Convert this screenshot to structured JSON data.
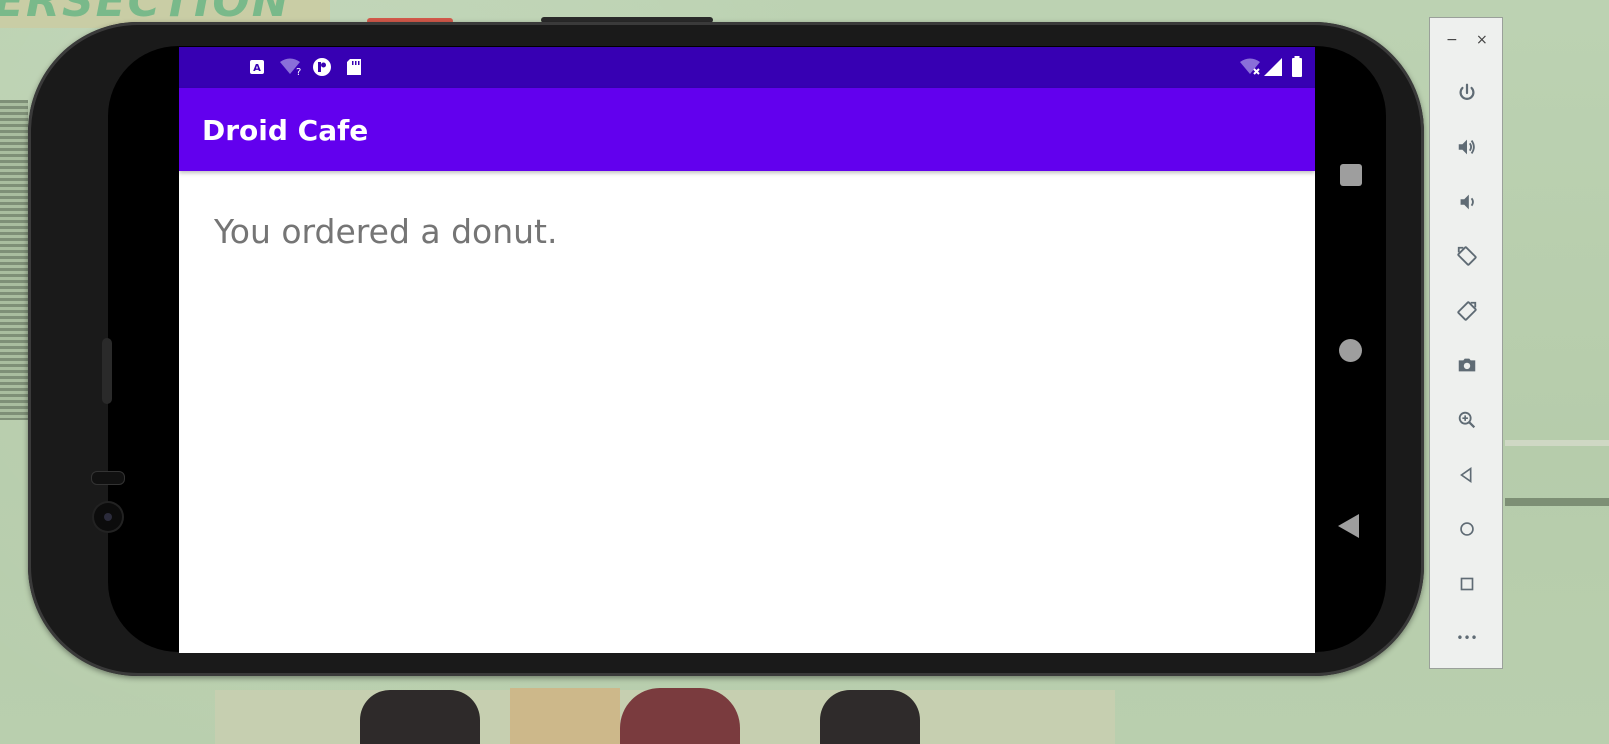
{
  "wallpaper": {
    "title_fragment": "ERSECTION"
  },
  "status_bar": {
    "left_icons": [
      "a-icon",
      "wifi-question-icon",
      "notification-icon",
      "sd-card-icon"
    ],
    "right_icons": [
      "wifi-off-icon",
      "signal-icon",
      "battery-icon"
    ]
  },
  "app_bar": {
    "title": "Droid Cafe"
  },
  "content": {
    "message": "You ordered a donut."
  },
  "emulator_toolbar": {
    "window_minimize": "−",
    "window_close": "×",
    "buttons": [
      "power",
      "volume-up",
      "volume-down",
      "rotate-left",
      "rotate-right",
      "screenshot",
      "zoom",
      "back",
      "home",
      "overview",
      "more"
    ],
    "more_label": "•••"
  },
  "colors": {
    "status_bar": "#3700b3",
    "app_bar": "#6200ee",
    "message_text": "#757575"
  }
}
